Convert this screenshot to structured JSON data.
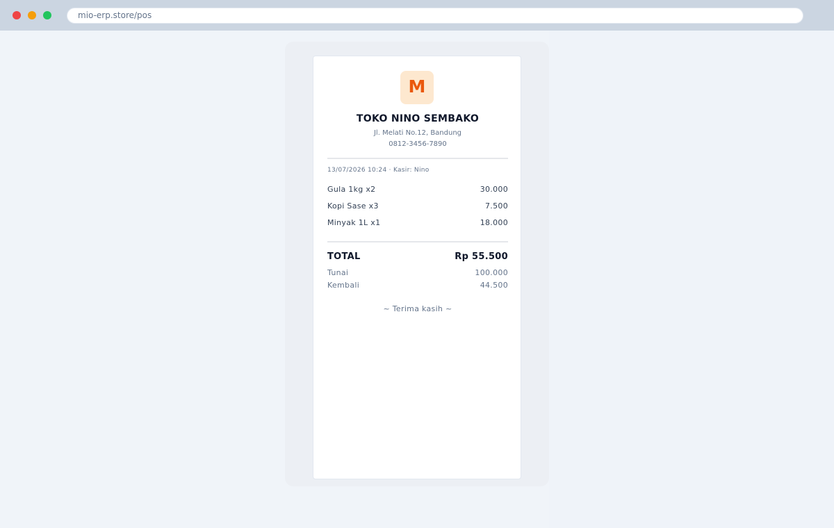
{
  "browser": {
    "url": "mio-erp.store/pos"
  },
  "receipt": {
    "logo_letter": "M",
    "store_name": "TOKO NINO SEMBAKO",
    "address": "Jl. Melati No.12, Bandung",
    "phone": "0812-3456-7890",
    "meta": "13/07/2026 10:24 · Kasir: Nino",
    "items": [
      {
        "name": "Gula 1kg x2",
        "amount": "30.000"
      },
      {
        "name": "Kopi Sase x3",
        "amount": "7.500"
      },
      {
        "name": "Minyak 1L x1",
        "amount": "18.000"
      }
    ],
    "total_label": "TOTAL",
    "total_amount": "Rp 55.500",
    "cash_label": "Tunai",
    "cash_amount": "100.000",
    "change_label": "Kembali",
    "change_amount": "44.500",
    "thanks": "~ Terima kasih ~"
  },
  "colors": {
    "accent": "#ea580c",
    "logo_bg": "#fde8cf",
    "window_close": "#ef4444",
    "window_minimize": "#f59e0b",
    "window_maximize": "#22c55e"
  }
}
